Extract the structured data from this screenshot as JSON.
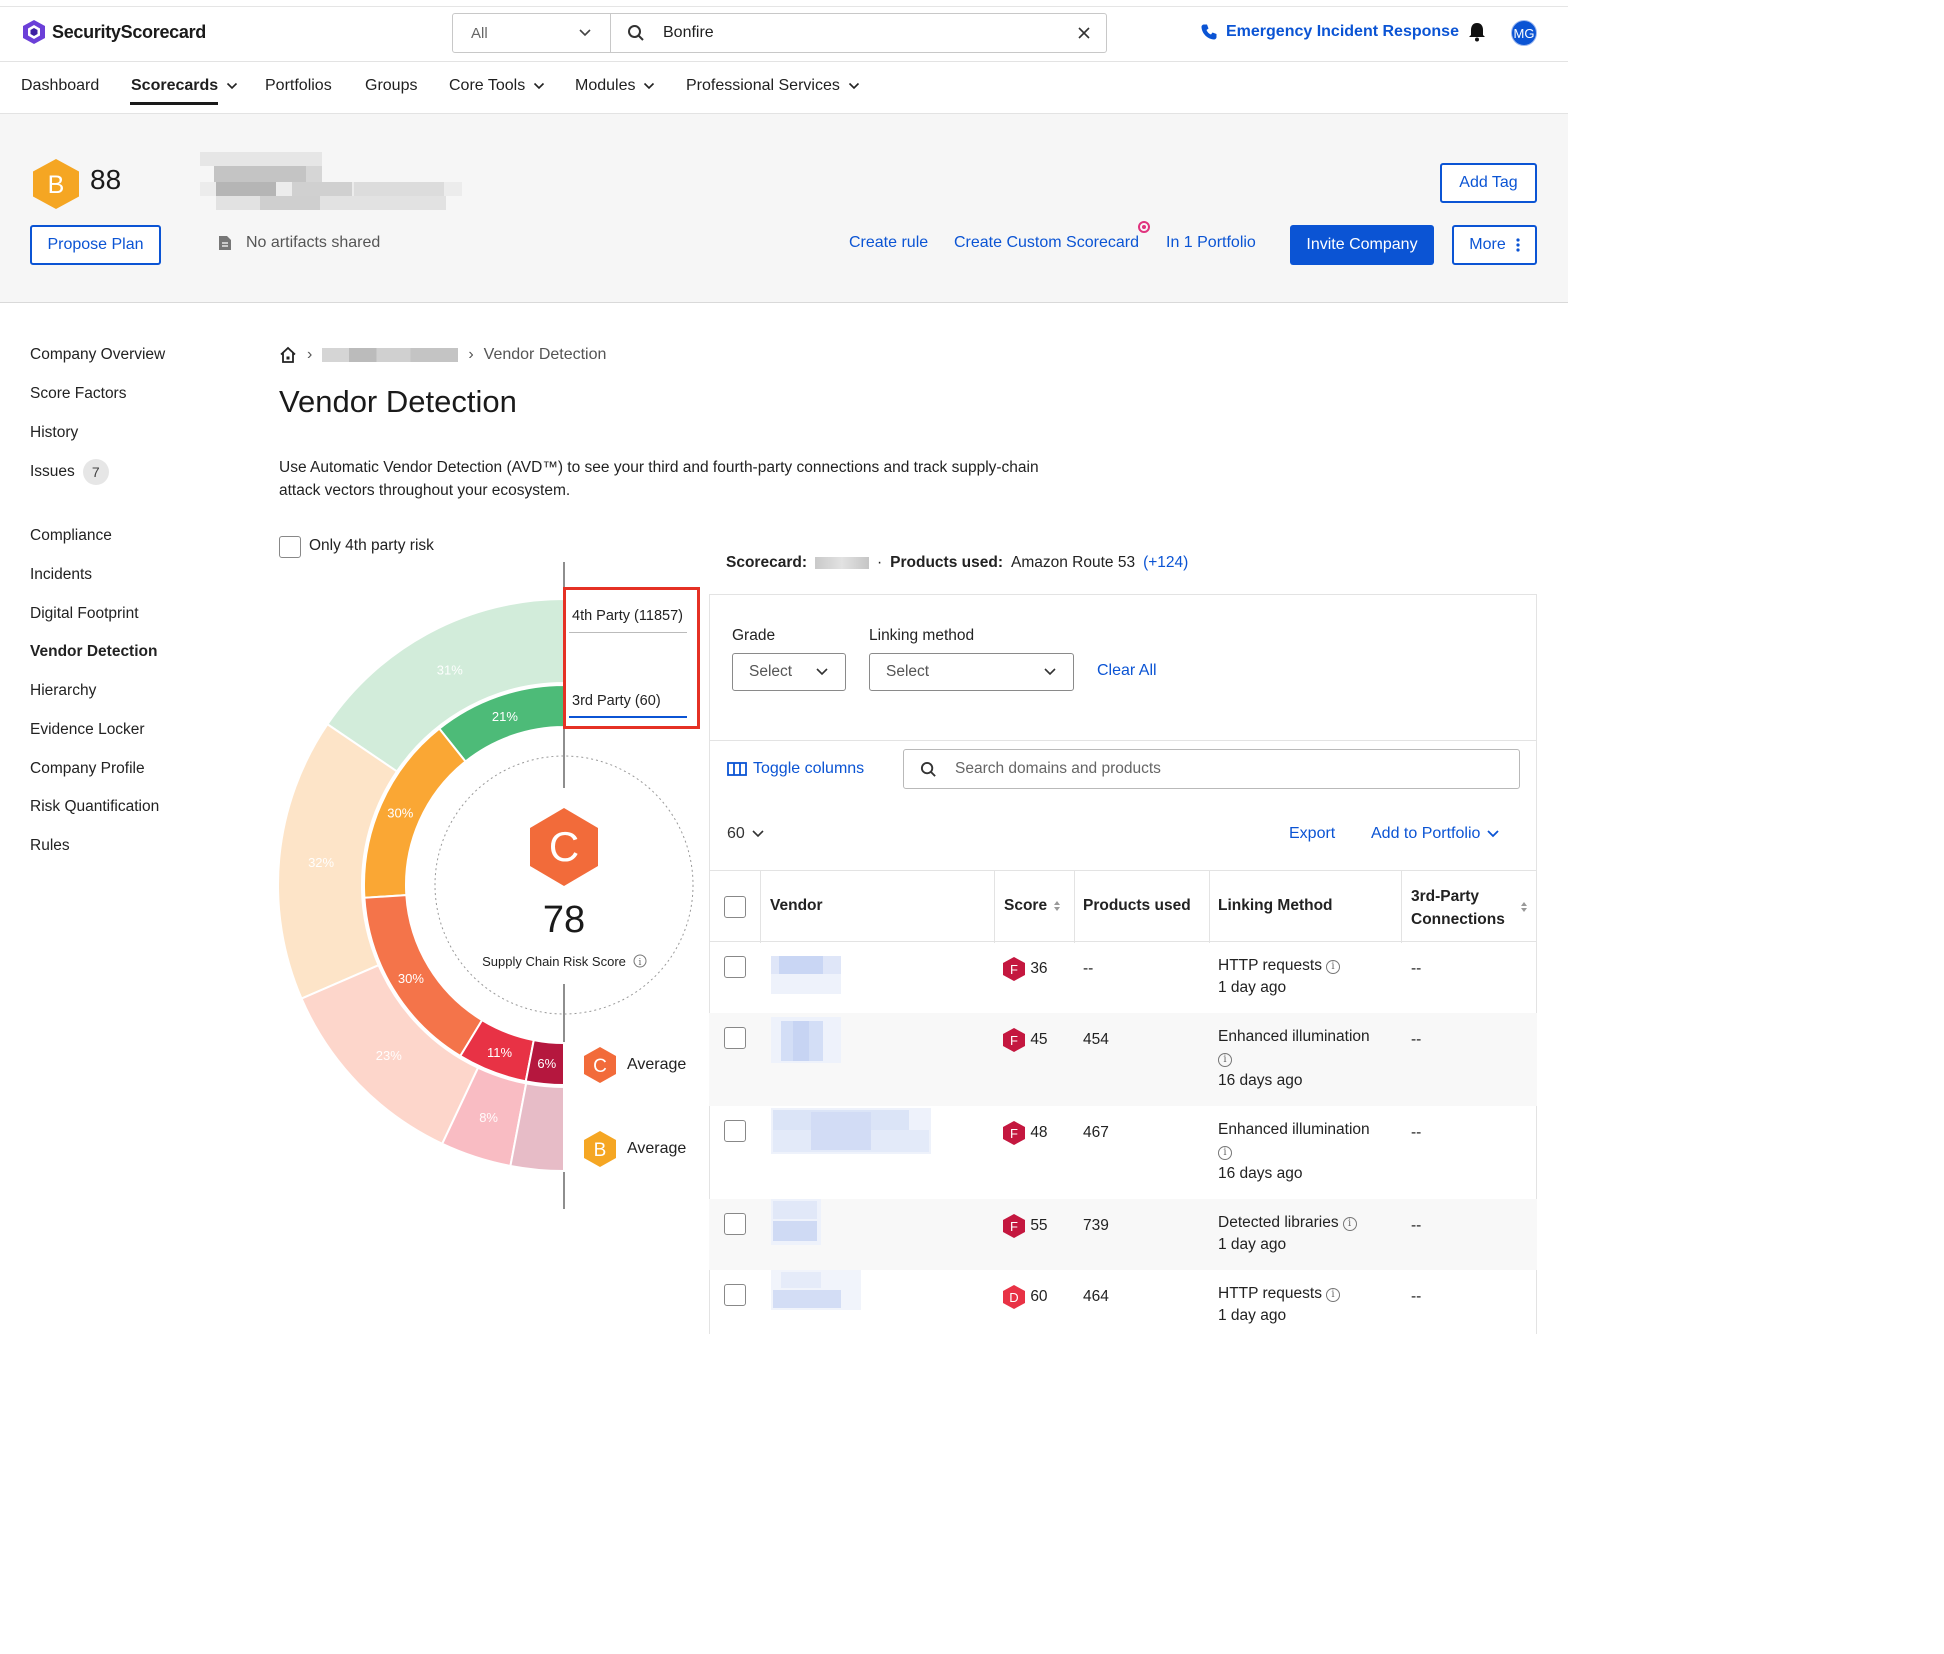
{
  "app": {
    "brand": "SecurityScorecard",
    "search_scope": "All",
    "search_value": "Bonfire",
    "emergency_label": "Emergency Incident Response",
    "avatar_initials": "MG"
  },
  "nav": {
    "items": [
      "Dashboard",
      "Scorecards",
      "Portfolios",
      "Groups",
      "Core Tools",
      "Modules",
      "Professional Services"
    ],
    "active": "Scorecards"
  },
  "company": {
    "grade": "B",
    "score": "88",
    "add_tag": "Add Tag",
    "propose_plan": "Propose Plan",
    "no_artifacts": "No artifacts shared",
    "create_rule": "Create rule",
    "create_custom_scorecard": "Create Custom Scorecard",
    "in_portfolio": "In 1 Portfolio",
    "invite_company": "Invite Company",
    "more": "More"
  },
  "sidebar": {
    "items": [
      "Company Overview",
      "Score Factors",
      "History",
      "Issues",
      "Compliance",
      "Incidents",
      "Digital Footprint",
      "Vendor Detection",
      "Hierarchy",
      "Evidence Locker",
      "Company Profile",
      "Risk Quantification",
      "Rules"
    ],
    "issues_count": "7",
    "active": "Vendor Detection"
  },
  "page": {
    "breadcrumb_current": "Vendor Detection",
    "title": "Vendor Detection",
    "description": "Use Automatic Vendor Detection (AVD™) to see your third and fourth-party connections and track supply-chain attack vectors throughout your ecosystem.",
    "only_4th_party": "Only 4th party risk"
  },
  "chart": {
    "center_grade": "C",
    "center_score": "78",
    "center_label": "Supply Chain Risk Score",
    "tab_4th": "4th Party (11857)",
    "tab_3rd": "3rd Party (60)",
    "avg_c_grade": "C",
    "avg_c_label": "Average",
    "avg_b_grade": "B",
    "avg_b_label": "Average"
  },
  "chart_data": {
    "type": "pie",
    "rings": [
      {
        "name": "3rd Party",
        "slices": [
          {
            "grade": "A",
            "percent": 21,
            "label": "21%",
            "color": "#4dbb78"
          },
          {
            "grade": "B",
            "percent": 30,
            "label": "30%",
            "color": "#faa734"
          },
          {
            "grade": "C",
            "percent": 30,
            "label": "30%",
            "color": "#f4744a"
          },
          {
            "grade": "D",
            "percent": 11,
            "label": "11%",
            "color": "#e83245"
          },
          {
            "grade": "F",
            "percent": 6,
            "label": "6%",
            "color": "#b5173e"
          }
        ]
      },
      {
        "name": "4th Party",
        "slices": [
          {
            "grade": "A",
            "percent": 31,
            "label": "31%",
            "color": "#d2ecda"
          },
          {
            "grade": "B",
            "percent": 32,
            "label": "32%",
            "color": "#fde4c8"
          },
          {
            "grade": "C",
            "percent": 23,
            "label": "23%",
            "color": "#fdd6cb"
          },
          {
            "grade": "D",
            "percent": 8,
            "label": "8%",
            "color": "#f9bcc3"
          },
          {
            "grade": "F",
            "percent": 6,
            "label": "",
            "color": "#e7bcc7"
          }
        ]
      }
    ]
  },
  "panel": {
    "scorecard_label": "Scorecard:",
    "products_used_label": "Products used:",
    "products_used_value": "Amazon Route 53",
    "products_more": "(+124)",
    "grade_label": "Grade",
    "grade_placeholder": "Select",
    "linking_label": "Linking method",
    "linking_placeholder": "Select",
    "clear_all": "Clear All",
    "toggle_columns": "Toggle columns",
    "search_placeholder": "Search domains and products",
    "page_size": "60",
    "export": "Export",
    "add_to_portfolio": "Add to Portfolio"
  },
  "table": {
    "headers": {
      "vendor": "Vendor",
      "score": "Score",
      "products": "Products used",
      "linking": "Linking Method",
      "connections": "3rd-Party Connections"
    },
    "rows": [
      {
        "grade": "F",
        "score": "36",
        "products": "--",
        "method": "HTTP requests",
        "when": "1 day ago",
        "connections": "--"
      },
      {
        "grade": "F",
        "score": "45",
        "products": "454",
        "method": "Enhanced illumination",
        "when": "16 days ago",
        "connections": "--"
      },
      {
        "grade": "F",
        "score": "48",
        "products": "467",
        "method": "Enhanced illumination",
        "when": "16 days ago",
        "connections": "--"
      },
      {
        "grade": "F",
        "score": "55",
        "products": "739",
        "method": "Detected libraries",
        "when": "1 day ago",
        "connections": "--"
      },
      {
        "grade": "D",
        "score": "60",
        "products": "464",
        "method": "HTTP requests",
        "when": "1 day ago",
        "connections": "--"
      }
    ]
  }
}
